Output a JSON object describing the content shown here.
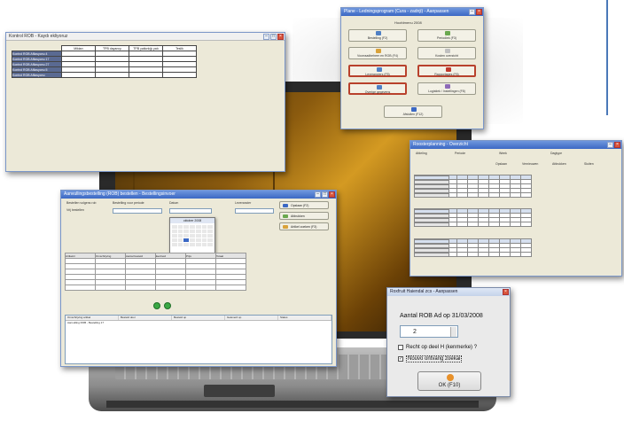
{
  "table_window": {
    "title": "Kontrol ROB - Kaydı ekliyoruz",
    "columns": [
      "",
      "Miktarı",
      "TPB dayanışı",
      "TPB yatkınlığı yatı",
      "Teslik"
    ],
    "rows": [
      [
        "Kontrol ROB Afilasyonu 4",
        "",
        "",
        "",
        ""
      ],
      [
        "Kontrol ROB Afilasyonu 17",
        "",
        "",
        "",
        ""
      ],
      [
        "Kontrol ROB Afilasyonu 27",
        "",
        "",
        "",
        ""
      ],
      [
        "Kontrol ROB Afilasyonu 5",
        "",
        "",
        "",
        ""
      ],
      [
        "Kontrol ROB Afilasyonu",
        "",
        "",
        "",
        ""
      ]
    ]
  },
  "menu_window": {
    "title": "Plane - Ledningsprogram (Cura - zadnji) - Aanpassen",
    "heading": "Hoofdmenu 2008",
    "buttons": [
      {
        "label": "Bestelling (F2)",
        "icon": "list-icon"
      },
      {
        "label": "Periodiek (F3)",
        "icon": "calendar-icon"
      },
      {
        "label": "Voorraadbeheer en ROB (F4)",
        "icon": "box-icon"
      },
      {
        "label": "Kosten overzicht",
        "icon": "chart-icon"
      },
      {
        "label": "Leveranciers (F5)",
        "icon": "truck-icon"
      },
      {
        "label": "Rapportages (F6)",
        "icon": "report-icon"
      },
      {
        "label": "Overige gegevens",
        "icon": "data-icon"
      },
      {
        "label": "Logistiek / Instellingen (F8)",
        "icon": "settings-icon"
      },
      {
        "label": "Afsluiten (F12)",
        "icon": "exit-icon"
      }
    ]
  },
  "grid_window": {
    "title": "Roosterplanning - Overzicht",
    "filters": [
      "Afdeling",
      "Periode",
      "Week",
      "Dagtype"
    ],
    "toolbar": [
      "Opslaan",
      "Vernieuwen",
      "Afdrukken",
      "Sluiten"
    ]
  },
  "form_window": {
    "title": "Aanvullingsbestelling (ROB) bestellen - Bestellingsinvoer",
    "radio_1": "Bestellen volgens rob",
    "radio_2": "Vrij bestellen",
    "field_label_1": "Bestelling voor periode",
    "field_label_2": "Datum",
    "field_label_3": "Leverancier",
    "calendar_title": "oktober 2008",
    "calendar_today": "Vandaag",
    "side_buttons": [
      "Opslaan (F2)",
      "Afdrukken",
      "Artikel zoeken (F3)"
    ],
    "grid_header": [
      "Artikelnr",
      "Omschrijving",
      "Aantal besteld",
      "Eenheid",
      "Prijs",
      "Totaal"
    ],
    "list_headers": [
      "Omschrijving artikel",
      "Besteld door",
      "Besteld op",
      "Geleverd op",
      "Status"
    ],
    "list_row": "Aanvulling ROB - Bestelling 17"
  },
  "dialog_window": {
    "title": "Roxfruit Haiendal zcs - Aanpassen",
    "question": "Aantal ROB Ad op 31/03/2008",
    "value": "2",
    "check_1": "Recht op deel H (kenmerke) ?",
    "check_2": "Nouvo ontvang zoekai",
    "check_2_checked": "✓",
    "ok_label": "OK (F10)"
  },
  "colors": {
    "accent_blue": "#3b68c4",
    "highlight_red": "#b8412c",
    "laptop_screen": "#d49a22"
  }
}
